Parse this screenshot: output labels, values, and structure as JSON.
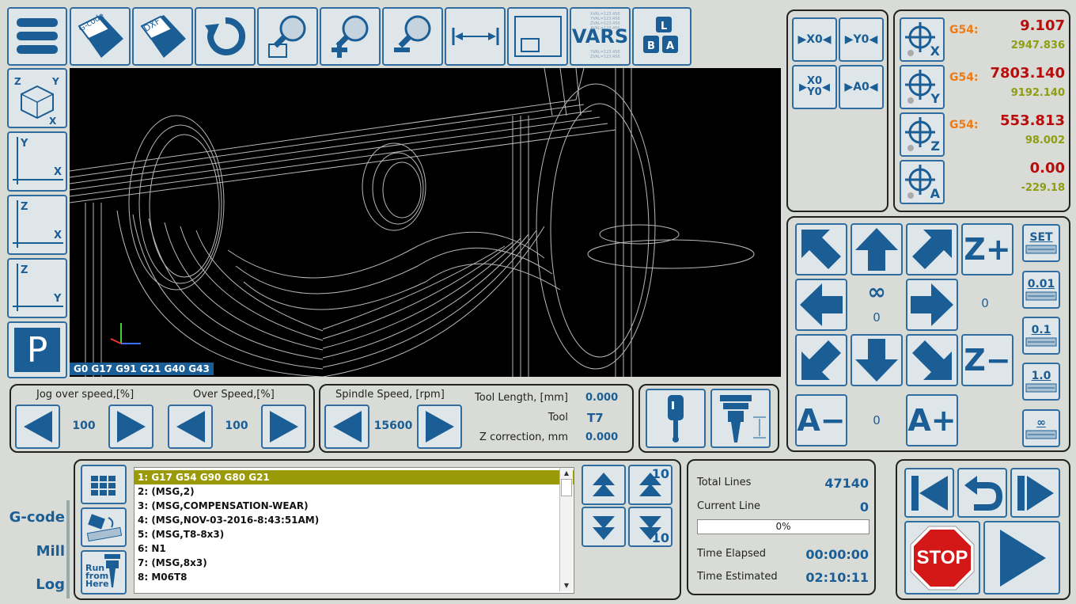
{
  "toolbar": {
    "gcode_label": "G-code",
    "dxf_label": "DXF",
    "vars_label": "VARS",
    "vars_text_lines": [
      "XVAL=123.456",
      "YVAL=123.456",
      "ZVAL=123.456",
      "AVAL=123.456"
    ],
    "keys": [
      "L",
      "B",
      "A"
    ]
  },
  "view_buttons": {
    "iso": {
      "z": "Z",
      "y": "Y",
      "x": "X"
    },
    "xy": {
      "v": "Y",
      "h": "X"
    },
    "zx": {
      "v": "Z",
      "h": "X"
    },
    "zy": {
      "v": "Z",
      "h": "Y"
    },
    "park": "P"
  },
  "viewport": {
    "status": "G0  G17 G91 G21 G40 G43"
  },
  "zero_buttons": {
    "x0": "X0",
    "y0": "Y0",
    "xy0_top": "X0",
    "xy0_bottom": "Y0",
    "a0": "A0"
  },
  "dro": {
    "axes": [
      {
        "axis": "X",
        "wcs": "G54:",
        "work": "9.107",
        "machine": "2947.836"
      },
      {
        "axis": "Y",
        "wcs": "G54:",
        "work": "7803.140",
        "machine": "9192.140"
      },
      {
        "axis": "Z",
        "wcs": "G54:",
        "work": "553.813",
        "machine": "98.002"
      },
      {
        "axis": "A",
        "wcs": "",
        "work": "0.00",
        "machine": "-229.18"
      }
    ]
  },
  "jog": {
    "infinity": "∞",
    "xy_step": "0",
    "z_step": "0",
    "a_step": "0",
    "z_plus": "Z+",
    "z_minus": "Z−",
    "a_minus": "A−",
    "a_plus": "A+",
    "steps": [
      "SET",
      "0.01",
      "0.1",
      "1.0",
      "∞"
    ]
  },
  "speed": {
    "jog_over_label": "Jog over speed,[%]",
    "jog_over_value": "100",
    "over_label": "Over Speed,[%]",
    "over_value": "100",
    "spindle_label": "Spindle Speed, [rpm]",
    "spindle_value": "15600",
    "tool_length_label": "Tool Length, [mm]",
    "tool_length_value": "0.000",
    "tool_label": "Tool",
    "tool_value": "T7",
    "zcorr_label": "Z correction, mm",
    "zcorr_value": "0.000"
  },
  "tabs": [
    "G-code",
    "Mill",
    "Log"
  ],
  "gcode": {
    "lines": [
      "1: G17 G54 G90 G80 G21",
      "2: (MSG,2)",
      "3: (MSG,COMPENSATION-WEAR)",
      "4: (MSG,NOV-03-2016-8:43:51AM)",
      "5: (MSG,T8-8x3)",
      "6: N1",
      "7: (MSG,8x3)",
      "8: M06T8"
    ],
    "run_from_here": [
      "Run",
      "from",
      "Here"
    ],
    "scroll10_up": "10",
    "scroll10_down": "10"
  },
  "stats": {
    "total_lines_label": "Total Lines",
    "total_lines_value": "47140",
    "current_line_label": "Current Line",
    "current_line_value": "0",
    "progress_percent": 0,
    "progress_text": "0%",
    "time_elapsed_label": "Time Elapsed",
    "time_elapsed_value": "00:00:00",
    "time_estimated_label": "Time Estimated",
    "time_estimated_value": "02:10:11"
  },
  "run_controls": {
    "stop_label": "STOP"
  },
  "colors": {
    "accent": "#1b5e96",
    "wcs": "#f07a10",
    "work": "#b80d0d",
    "machine": "#8e9d12",
    "selected_line": "#9a9a08"
  }
}
